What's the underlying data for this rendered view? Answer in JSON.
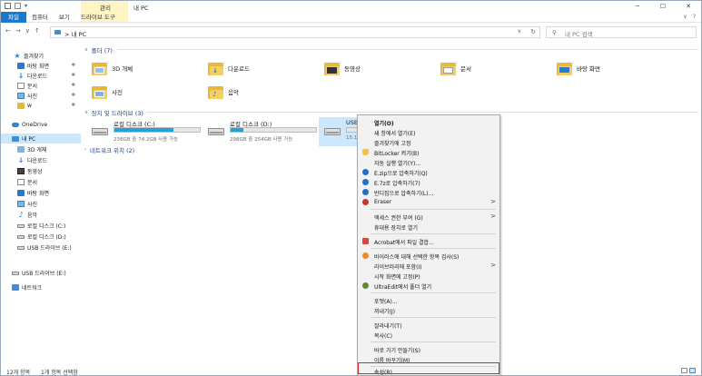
{
  "window": {
    "title": "내 PC",
    "context_tab_group": "관리",
    "controls": [
      "─",
      "☐",
      "✕"
    ]
  },
  "ribbon": {
    "tabs": [
      "파일",
      "컴퓨터",
      "보기",
      "드라이브 도구"
    ],
    "right": [
      "∨",
      "?"
    ]
  },
  "address": {
    "path": "내 PC",
    "separator": ">",
    "dropdown": "∨",
    "refresh": "↻",
    "search_placeholder": "내 PC 검색"
  },
  "nav": {
    "quick_access": "즐겨찾기",
    "quick_items": [
      "바탕 화면",
      "다운로드",
      "문서",
      "사진",
      "w"
    ],
    "onedrive": "OneDrive",
    "this_pc": "내 PC",
    "pc_items": [
      "3D 개체",
      "다운로드",
      "동영상",
      "문서",
      "바탕 화면",
      "사진",
      "음악",
      "로컬 디스크 (C:)",
      "로컬 디스크 (D:)",
      "USB 드라이브 (E:)"
    ],
    "usb": "USB 드라이브 (E:)",
    "network": "네트워크"
  },
  "content": {
    "folders_header": "폴더 (7)",
    "folders": [
      "3D 개체",
      "다운로드",
      "동영상",
      "문서",
      "바탕 화면",
      "사진",
      "음악"
    ],
    "drives_header": "장치 및 드라이브 (3)",
    "drives": [
      {
        "name": "로컬 디스크 (C:)",
        "size": "238GB 중 74.2GB 사용 가능",
        "used_fraction": 0.69
      },
      {
        "name": "로컬 디스크 (D:)",
        "size": "298GB 중 254GB 사용 가능",
        "used_fraction": 0.15
      },
      {
        "name": "USB",
        "size": "15.1",
        "used_fraction": 0.0
      }
    ],
    "network_header": "네트워크 위치 (2)"
  },
  "status": {
    "count": "12개 항목",
    "selection": "1개 항목 선택함"
  },
  "context_menu": {
    "items": [
      "열기(O)",
      "새 창에서 열기(E)",
      "즐겨찾기에 고정",
      "BitLocker 켜기(B)",
      "자동 실행 열기(Y)...",
      "E.zip으로 압축하기(Q)",
      "E.7z로 압축하기(7)",
      "반디집으로 압축하기(L)...",
      "Eraser",
      "액세스 권한 부여 (G)",
      "휴대용 장치로 열기",
      "Acrobat에서 파일 결합...",
      "바이러스에 대해 선택한 항목 검사(S)",
      "라이브러리에 포함(I)",
      "시작 화면에 고정(P)",
      "UltraEdit에서 폴더 열기",
      "포맷(A)...",
      "꺼내기(J)",
      "잘라내기(T)",
      "복사(C)",
      "바로 가기 만들기(S)",
      "이름 바꾸기(M)",
      "속성(R)"
    ],
    "submenu_arrow": ">"
  },
  "colors": {
    "accent": "#1979ca",
    "selection": "#cce8ff",
    "drive_bar": "#26a0da",
    "highlight_box": "#d62b2b",
    "management_band": "#fff4c4"
  }
}
